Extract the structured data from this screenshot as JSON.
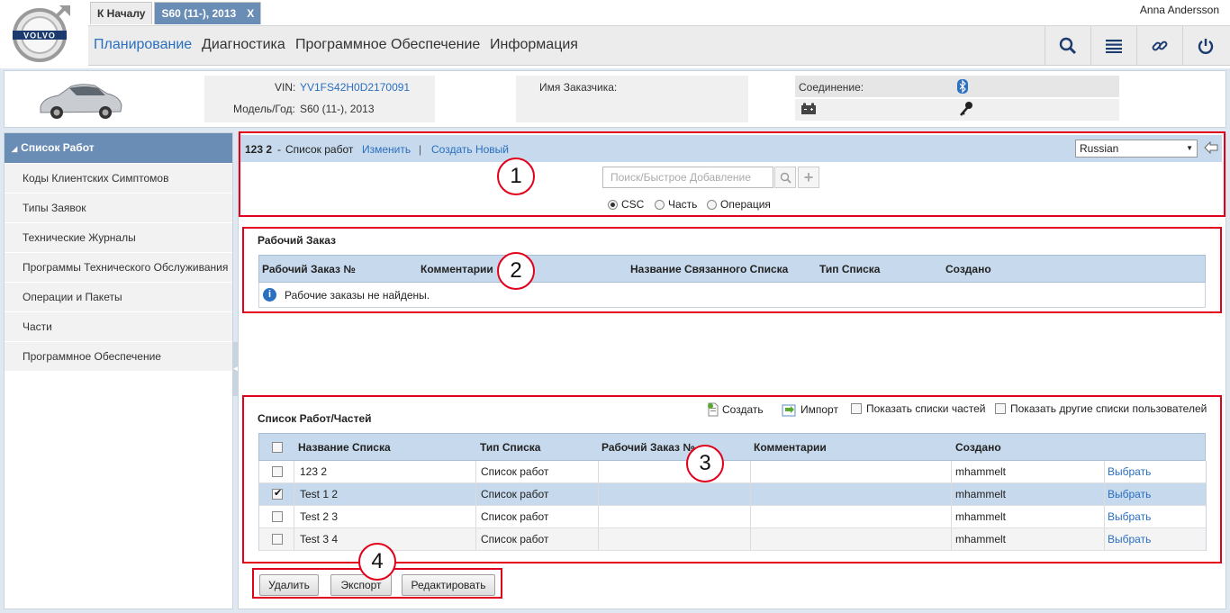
{
  "user": {
    "name": "Anna Andersson"
  },
  "tabs": [
    {
      "label": "К Началу"
    },
    {
      "label": "S60 (11-), 2013",
      "close": "X"
    }
  ],
  "menu": [
    "Планирование",
    "Диагностика",
    "Программное Обеспечение",
    "Информация"
  ],
  "vehicle": {
    "vin_label": "VIN:",
    "vin": "YV1FS42H0D2170091",
    "model_label": "Модель/Год:",
    "model": "S60 (11-), 2013",
    "customer_label": "Имя Заказчика:",
    "connection_label": "Соединение:"
  },
  "sidebar": {
    "header": "Список Работ",
    "items": [
      "Коды Клиентских Симптомов",
      "Типы Заявок",
      "Технические Журналы",
      "Программы Технического Обслуживания",
      "Операции и Пакеты",
      "Части",
      "Программное Обеспечение"
    ]
  },
  "worklist": {
    "id": "123 2",
    "separator": "-",
    "type": "Список работ",
    "edit": "Изменить",
    "pipe": "|",
    "create_new": "Создать Новый",
    "language": "Russian",
    "search_placeholder": "Поиск/Быстрое Добавление",
    "radios": [
      "CSC",
      "Часть",
      "Операция"
    ],
    "selected_radio": "CSC"
  },
  "work_order": {
    "title": "Рабочий Заказ",
    "columns": [
      "Рабочий Заказ №",
      "Комментарии",
      "Название Связанного Списка",
      "Тип Списка",
      "Создано"
    ],
    "empty_message": "Рабочие заказы не найдены."
  },
  "parts_list": {
    "title": "Список Работ/Частей",
    "create": "Создать",
    "import": "Импорт",
    "show_parts": "Показать списки частей",
    "show_other_users": "Показать другие списки пользователей",
    "columns": [
      "Название Списка",
      "Тип Списка",
      "Рабочий Заказ №",
      "Комментарии",
      "Создано"
    ],
    "rows": [
      {
        "name": "123 2",
        "type": "Список работ",
        "order": "",
        "comment": "",
        "created": "mhammelt",
        "action": "Выбрать",
        "checked": false
      },
      {
        "name": "Test 1 2",
        "type": "Список работ",
        "order": "",
        "comment": "",
        "created": "mhammelt",
        "action": "Выбрать",
        "checked": true
      },
      {
        "name": "Test 2 3",
        "type": "Список работ",
        "order": "",
        "comment": "",
        "created": "mhammelt",
        "action": "Выбрать",
        "checked": false
      },
      {
        "name": "Test 3 4",
        "type": "Список работ",
        "order": "",
        "comment": "",
        "created": "mhammelt",
        "action": "Выбрать",
        "checked": false
      }
    ]
  },
  "actions": {
    "delete": "Удалить",
    "export": "Экспорт",
    "edit": "Редактировать"
  },
  "callouts": [
    "1",
    "2",
    "3",
    "4"
  ],
  "colors": {
    "accent": "#2a6fc0",
    "header_blue": "#6a8db5",
    "grid_blue": "#c7d9ec",
    "callout_red": "#e3001b",
    "selected_row": "#c7d9ec"
  }
}
